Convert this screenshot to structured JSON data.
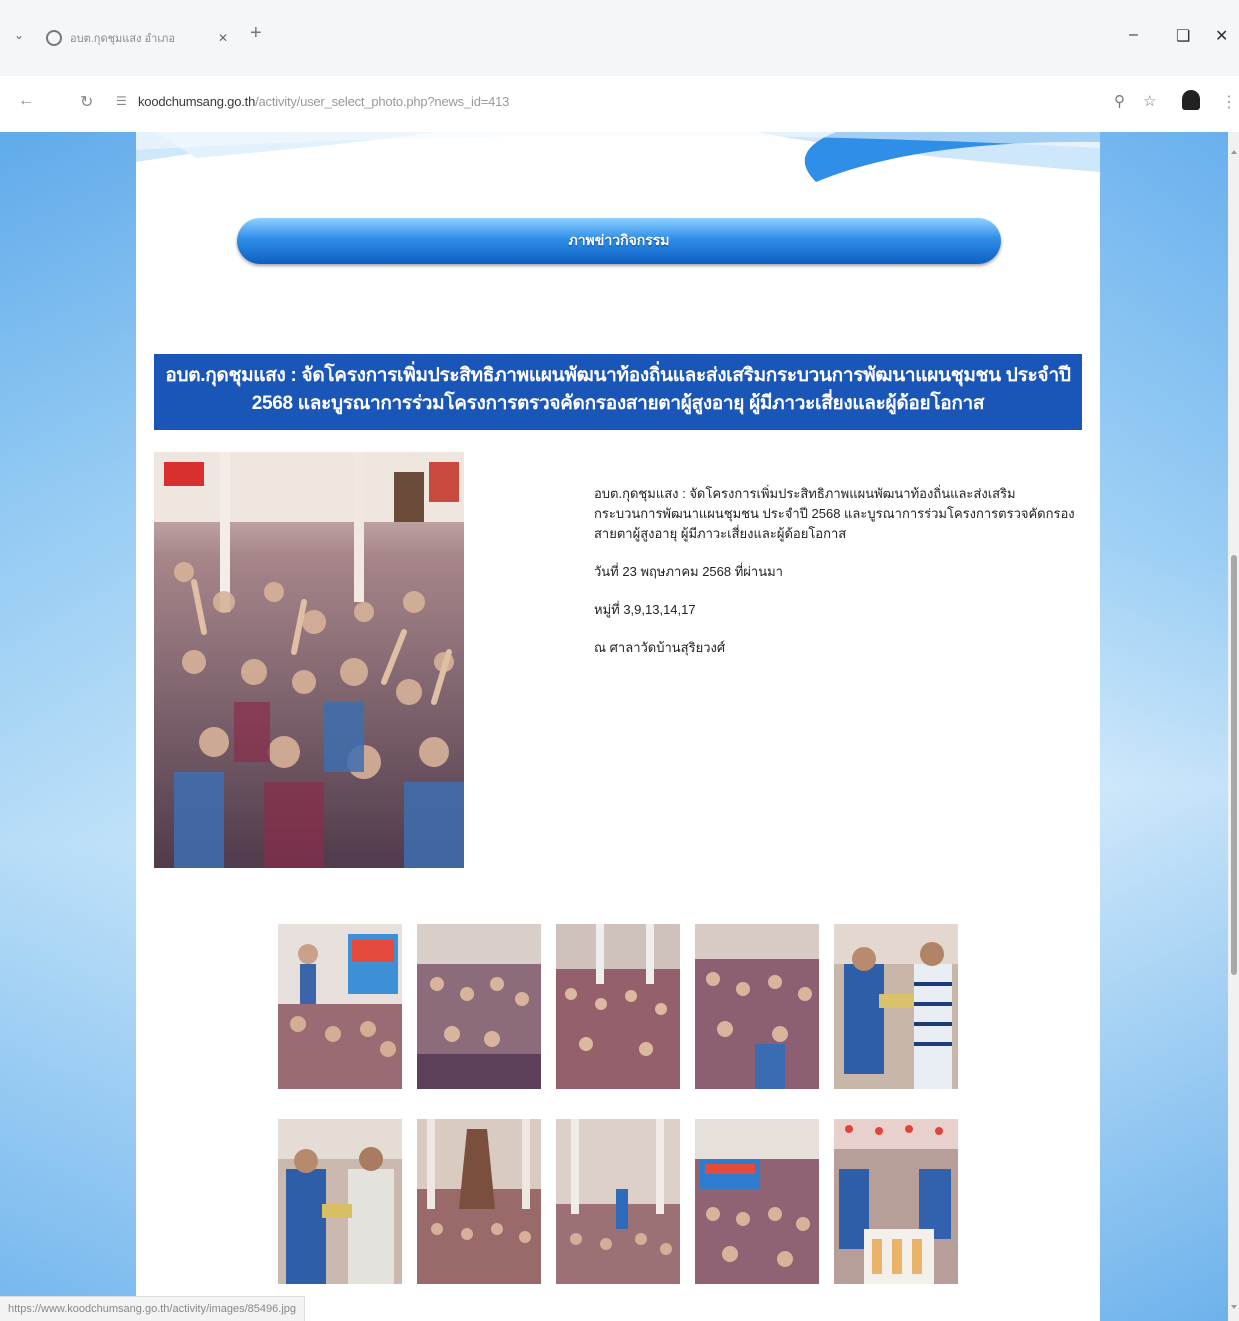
{
  "browser": {
    "tab_title": "อบต.กุดชุมแสง อำเภอ",
    "url_host": "koodchumsang.go.th",
    "url_path": "/activity/user_select_photo.php?news_id=413",
    "status_url": "https://www.koodchumsang.go.th/activity/images/85496.jpg",
    "icons": [
      "tab-search-icon",
      "globe-icon",
      "close-icon",
      "new-tab-icon",
      "minimize-icon",
      "restore-icon",
      "window-close-icon",
      "back-icon",
      "reload-icon",
      "site-info-icon",
      "zoom-icon",
      "bookmark-star-icon",
      "profile-icon",
      "more-menu-icon"
    ]
  },
  "page": {
    "section_heading": "ภาพข่าวกิจกรรม",
    "news_title": "อบต.กุดชุมแสง : จัดโครงการเพิ่มประสิทธิภาพแผนพัฒนาท้องถิ่นและส่งเสริมกระบวนการพัฒนาแผนชุมชน ประจำปี 2568 และบูรณาการร่วมโครงการตรวจคัดกรองสายตาผู้สูงอายุ ผู้มีภาวะเสี่ยงและผู้ด้อยโอกาส",
    "description": "อบต.กุดชุมแสง : จัดโครงการเพิ่มประสิทธิภาพแผนพัฒนาท้องถิ่นและส่งเสริมกระบวนการพัฒนาแผนชุมชน ประจำปี 2568 และบูรณาการร่วมโครงการตรวจคัดกรองสายตาผู้สูงอายุ ผู้มีภาวะเสี่ยงและผู้ด้อยโอกาส",
    "date_line": "วันที่ 23 พฤษภาคม 2568 ที่ผ่านมา",
    "villages_line": "หมู่ที่ 3,9,13,14,17",
    "venue_line": "ณ ศาลาวัดบ้านสุริยวงศ์",
    "thumbnails": [
      "thumb-1",
      "thumb-2",
      "thumb-3",
      "thumb-4",
      "thumb-5",
      "thumb-6",
      "thumb-7",
      "thumb-8",
      "thumb-9",
      "thumb-10"
    ]
  },
  "colors": {
    "title_bar": "#1a55b8",
    "pill_top": "#8fd0ff",
    "pill_bottom": "#0e5fc1",
    "side_gradient": "#6fb7ef"
  }
}
